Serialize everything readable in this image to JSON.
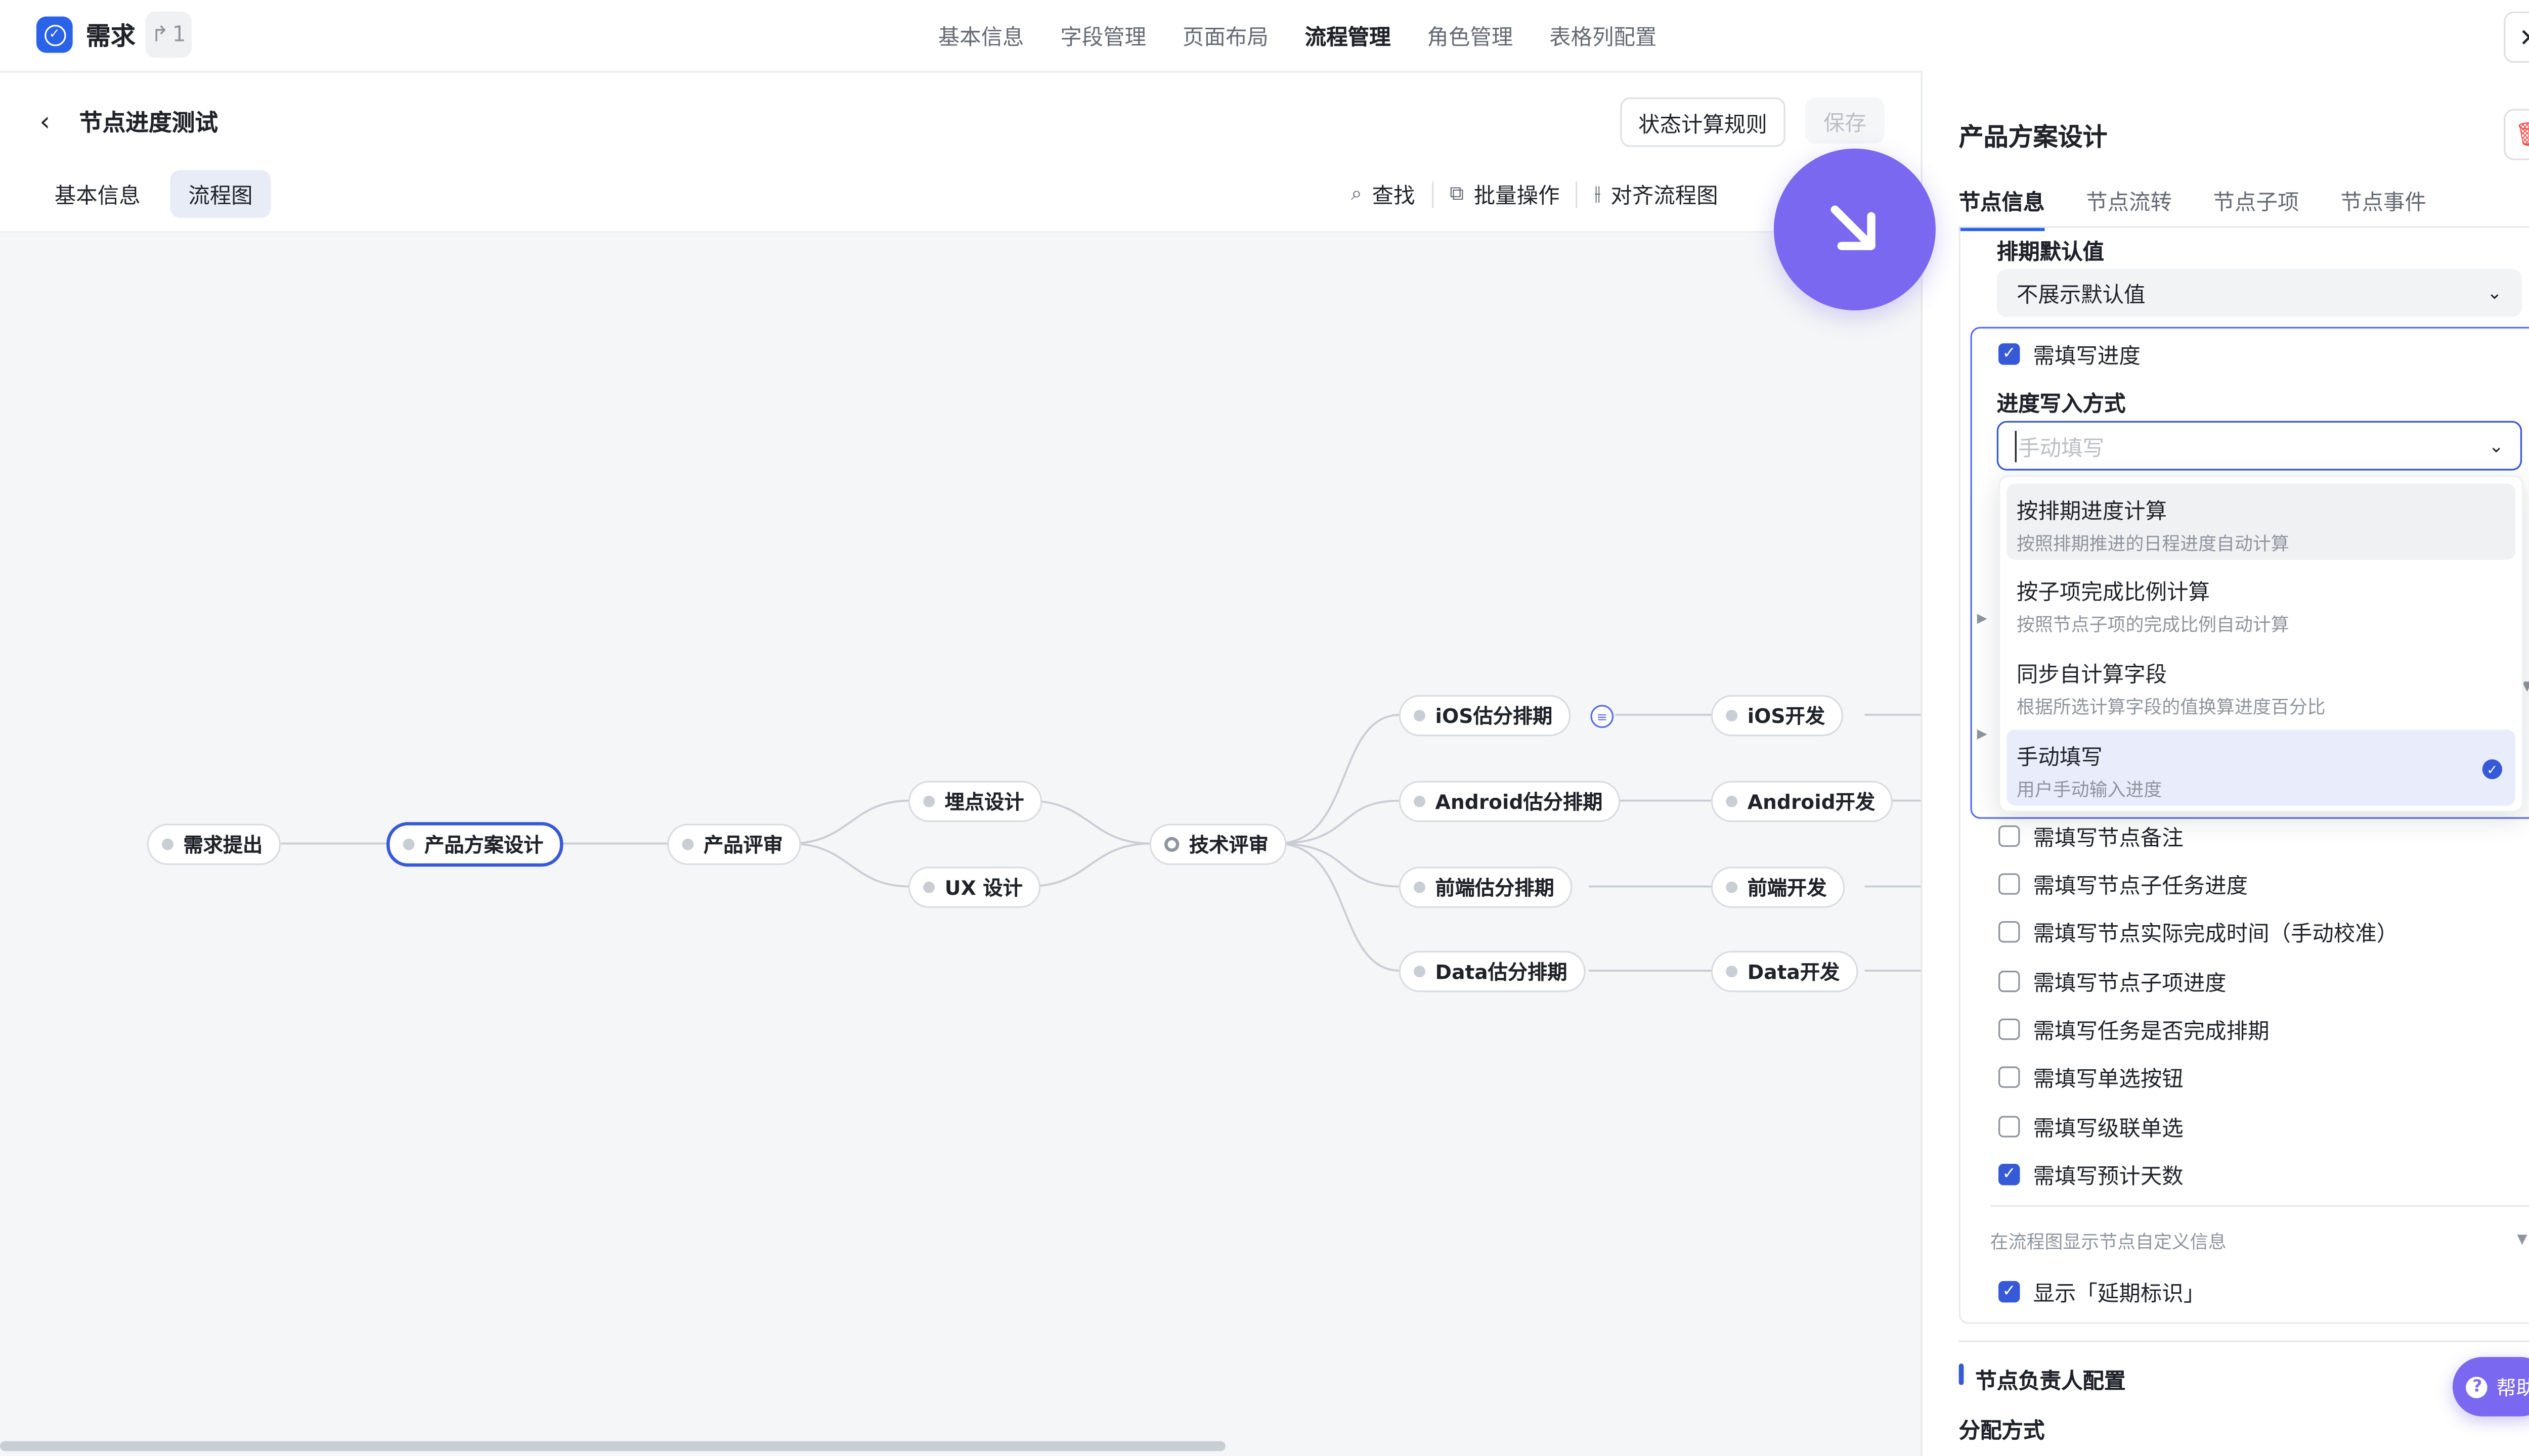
{
  "app": {
    "title": "需求",
    "share_count": "1"
  },
  "top_nav": [
    "基本信息",
    "字段管理",
    "页面布局",
    "流程管理",
    "角色管理",
    "表格列配置"
  ],
  "top_nav_active": "流程管理",
  "header": {
    "page_title": "节点进度测试",
    "rule_button": "状态计算规则",
    "save_button": "保存"
  },
  "sub_tabs": [
    "基本信息",
    "流程图"
  ],
  "sub_tab_active": "流程图",
  "toolbar": {
    "find": "查找",
    "batch": "批量操作",
    "align": "对齐流程图"
  },
  "flow_nodes": {
    "n1": "需求提出",
    "n2": "产品方案设计",
    "n3": "产品评审",
    "n4": "埋点设计",
    "n5": "UX 设计",
    "n6": "技术评审",
    "n7": "iOS估分排期",
    "n8": "Android估分排期",
    "n9": "前端估分排期",
    "n10": "Data估分排期",
    "n11": "iOS开发",
    "n12": "Android开发",
    "n13": "前端开发",
    "n14": "Data开发"
  },
  "panel": {
    "title": "产品方案设计",
    "tabs": [
      "节点信息",
      "节点流转",
      "节点子项",
      "节点事件"
    ],
    "tab_active": "节点信息",
    "schedule_default_label": "排期默认值",
    "schedule_default_value": "不展示默认值",
    "progress_required": "需填写进度",
    "progress_method_label": "进度写入方式",
    "progress_method_placeholder": "手动填写",
    "options": [
      {
        "title": "按排期进度计算",
        "desc": "按照排期推进的日程进度自动计算"
      },
      {
        "title": "按子项完成比例计算",
        "desc": "按照节点子项的完成比例自动计算"
      },
      {
        "title": "同步自计算字段",
        "desc": "根据所选计算字段的值换算进度百分比"
      },
      {
        "title": "手动填写",
        "desc": "用户手动输入进度"
      }
    ],
    "checkboxes": [
      {
        "label": "需填写节点备注",
        "checked": false
      },
      {
        "label": "需填写节点子任务进度",
        "checked": false
      },
      {
        "label": "需填写节点实际完成时间（手动校准）",
        "checked": false
      },
      {
        "label": "需填写节点子项进度",
        "checked": false
      },
      {
        "label": "需填写任务是否完成排期",
        "checked": false
      },
      {
        "label": "需填写单选按钮",
        "checked": false
      },
      {
        "label": "需填写级联单选",
        "checked": false
      },
      {
        "label": "需填写预计天数",
        "checked": true
      }
    ],
    "custom_info_section": "在流程图显示节点自定义信息",
    "show_delay_label": "显示「延期标识」",
    "owner_section": "节点负责人配置",
    "assign_label": "分配方式",
    "help": "帮助"
  },
  "colors": {
    "accent": "#3659d8",
    "brand": "#2a63e8",
    "cursor": "#7b68f0",
    "danger": "#f54a45"
  }
}
